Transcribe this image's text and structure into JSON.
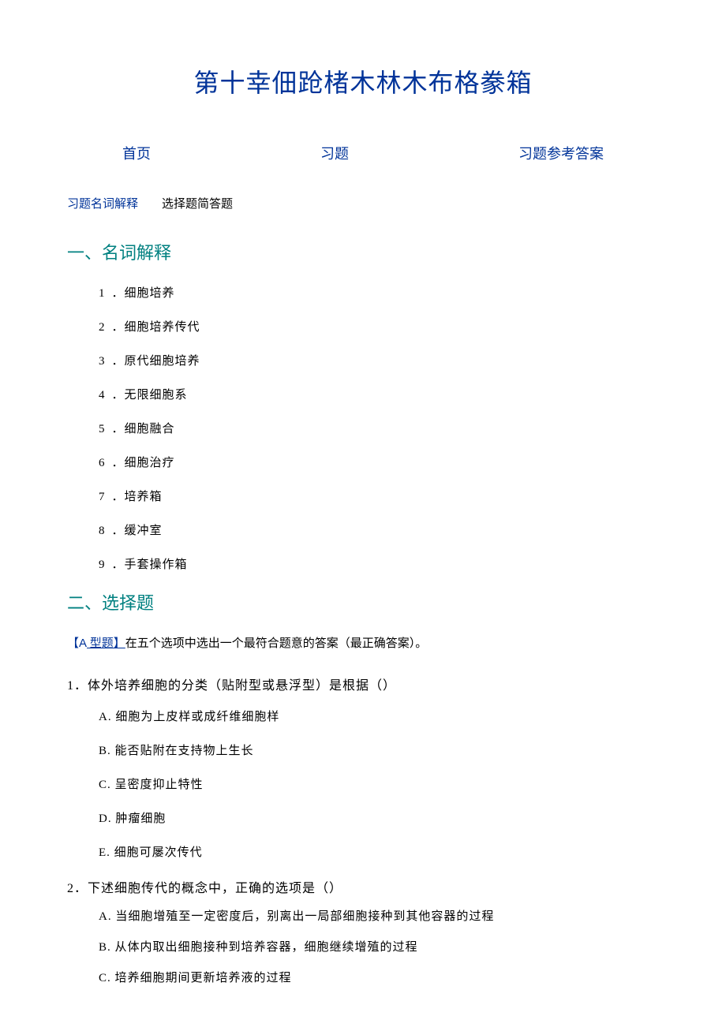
{
  "title": "第十幸佃跄楮木林木布格豢箱",
  "topNav": {
    "home": "首页",
    "exercises": "习题",
    "answers": "习题参考答案"
  },
  "subNav": {
    "part1": "习题名词解释",
    "part2": "选择题简答题"
  },
  "section1": {
    "header": "一、名词解释",
    "items": [
      {
        "num": "1",
        "text": "．细胞培养"
      },
      {
        "num": "2",
        "text": "．细胞培养传代"
      },
      {
        "num": "3",
        "text": "．原代细胞培养"
      },
      {
        "num": "4",
        "text": "．无限细胞系"
      },
      {
        "num": "5",
        "text": "．细胞融合"
      },
      {
        "num": "6",
        "text": "．细胞治疗"
      },
      {
        "num": "7",
        "text": "．培养箱"
      },
      {
        "num": "8",
        "text": "．缓冲室"
      },
      {
        "num": "9",
        "text": "．手套操作箱"
      }
    ]
  },
  "section2": {
    "header": "二、选择题",
    "aType": {
      "labelOpen": "【",
      "labelA": "A",
      "labelRest": " 型题】",
      "desc": "在五个选项中选出一个最符合题意的答案（最正确答案）。"
    },
    "questions": [
      {
        "num": "1",
        "text": "．体外培养细胞的分类（贴附型或悬浮型）是根据（）",
        "options": [
          "A. 细胞为上皮样或成纤维细胞样",
          "B. 能否贴附在支持物上生长",
          "C. 呈密度抑止特性",
          "D. 肿瘤细胞",
          "E. 细胞可屡次传代"
        ]
      },
      {
        "num": "2",
        "text": "．下述细胞传代的概念中，正确的选项是（）",
        "options": [
          "A. 当细胞增殖至一定密度后，别离出一局部细胞接种到其他容器的过程",
          "B. 从体内取出细胞接种到培养容器，细胞继续增殖的过程",
          "C. 培养细胞期间更新培养液的过程"
        ]
      }
    ]
  }
}
